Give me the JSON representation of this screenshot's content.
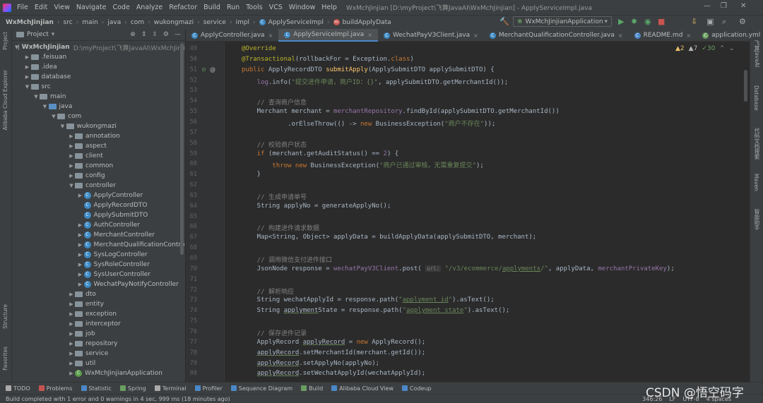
{
  "menu": [
    "File",
    "Edit",
    "View",
    "Navigate",
    "Code",
    "Analyze",
    "Refactor",
    "Build",
    "Run",
    "Tools",
    "VCS",
    "Window",
    "Help"
  ],
  "window_title": "WxMchJinjian [D:\\myProject\\飞算JavaAI\\WxMchJinjian] - ApplyServiceImpl.java",
  "breadcrumbs": [
    "WxMchJinjian",
    "src",
    "main",
    "java",
    "com",
    "wukongmazi",
    "service",
    "impl",
    "ApplyServiceImpl",
    "buildApplyData"
  ],
  "run_config": "WxMchJinjianApplication",
  "project_panel": {
    "title": "Project",
    "tree": [
      {
        "depth": 0,
        "label": "WxMchJinjian",
        "path": "D:\\myProject\\飞算JavaAI\\WxMchJinji",
        "type": "project",
        "open": true
      },
      {
        "depth": 1,
        "label": ".feisuan",
        "type": "folder",
        "open": false
      },
      {
        "depth": 1,
        "label": ".idea",
        "type": "folder",
        "open": false
      },
      {
        "depth": 1,
        "label": "database",
        "type": "folder",
        "open": false
      },
      {
        "depth": 1,
        "label": "src",
        "type": "folder",
        "open": true
      },
      {
        "depth": 2,
        "label": "main",
        "type": "folder",
        "open": true
      },
      {
        "depth": 3,
        "label": "java",
        "type": "src",
        "open": true
      },
      {
        "depth": 4,
        "label": "com",
        "type": "folder",
        "open": true
      },
      {
        "depth": 5,
        "label": "wukongmazi",
        "type": "folder",
        "open": true
      },
      {
        "depth": 6,
        "label": "annotation",
        "type": "folder",
        "open": false
      },
      {
        "depth": 6,
        "label": "aspect",
        "type": "folder",
        "open": false
      },
      {
        "depth": 6,
        "label": "client",
        "type": "folder",
        "open": false
      },
      {
        "depth": 6,
        "label": "common",
        "type": "folder",
        "open": false
      },
      {
        "depth": 6,
        "label": "config",
        "type": "folder",
        "open": false
      },
      {
        "depth": 6,
        "label": "controller",
        "type": "folder",
        "open": true
      },
      {
        "depth": 7,
        "label": "ApplyController",
        "type": "class",
        "open": false
      },
      {
        "depth": 7,
        "label": "ApplyRecordDTO",
        "type": "class",
        "open": null
      },
      {
        "depth": 7,
        "label": "ApplySubmitDTO",
        "type": "class",
        "open": null
      },
      {
        "depth": 7,
        "label": "AuthController",
        "type": "class",
        "open": false
      },
      {
        "depth": 7,
        "label": "MerchantController",
        "type": "class",
        "open": false
      },
      {
        "depth": 7,
        "label": "MerchantQualificationContro",
        "type": "class",
        "open": false
      },
      {
        "depth": 7,
        "label": "SysLogController",
        "type": "class",
        "open": false
      },
      {
        "depth": 7,
        "label": "SysRoleController",
        "type": "class",
        "open": false
      },
      {
        "depth": 7,
        "label": "SysUserController",
        "type": "class",
        "open": false
      },
      {
        "depth": 7,
        "label": "WechatPayNotifyController",
        "type": "class",
        "open": false
      },
      {
        "depth": 6,
        "label": "dto",
        "type": "folder",
        "open": false
      },
      {
        "depth": 6,
        "label": "entity",
        "type": "folder",
        "open": false
      },
      {
        "depth": 6,
        "label": "exception",
        "type": "folder",
        "open": false
      },
      {
        "depth": 6,
        "label": "interceptor",
        "type": "folder",
        "open": false
      },
      {
        "depth": 6,
        "label": "job",
        "type": "folder",
        "open": false
      },
      {
        "depth": 6,
        "label": "repository",
        "type": "folder",
        "open": false
      },
      {
        "depth": 6,
        "label": "service",
        "type": "folder",
        "open": false
      },
      {
        "depth": 6,
        "label": "util",
        "type": "folder",
        "open": false
      },
      {
        "depth": 6,
        "label": "WxMchJinjianApplication",
        "type": "spring",
        "open": false
      }
    ]
  },
  "tabs": [
    {
      "label": "ApplyController.java",
      "active": false,
      "icon": "#3d8ac4"
    },
    {
      "label": "ApplyServiceImpl.java",
      "active": true,
      "icon": "#3d8ac4"
    },
    {
      "label": "WechatPayV3Client.java",
      "active": false,
      "icon": "#3d8ac4"
    },
    {
      "label": "MerchantQualificationController.java",
      "active": false,
      "icon": "#3d8ac4"
    },
    {
      "label": "README.md",
      "active": false,
      "icon": "#4a88c7"
    },
    {
      "label": "application.yml",
      "active": false,
      "icon": "#6a9e61"
    }
  ],
  "inspection": {
    "warnings": "2",
    "weak": "7",
    "ok": "30"
  },
  "code_lines": [
    {
      "n": "49",
      "html": "<span class=\"ann\">@Override</span>"
    },
    {
      "n": "50",
      "html": "<span class=\"ann\">@Transactional</span>(rollbackFor = Exception.<span class=\"kw\">class</span>)"
    },
    {
      "n": "51",
      "html": "<span class=\"kw\">public</span> ApplyRecordDTO <span class=\"fn\">submitApply</span>(ApplySubmitDTO applySubmitDTO) {"
    },
    {
      "n": "52",
      "html": "    <span class=\"fld\">log</span>.info(<span class=\"str\">\"提交进件申请，商户ID：{}\"</span>, applySubmitDTO.getMerchantId());"
    },
    {
      "n": "53",
      "html": ""
    },
    {
      "n": "54",
      "html": "    <span class=\"cmt\">// 查询商户信息</span>"
    },
    {
      "n": "55",
      "html": "    Merchant merchant = <span class=\"fld\">merchantRepository</span>.findById(applySubmitDTO.getMerchantId())"
    },
    {
      "n": "56",
      "html": "            .orElseThrow(() -> <span class=\"kw\">new</span> BusinessException(<span class=\"str\">\"商户不存在\"</span>));"
    },
    {
      "n": "57",
      "html": ""
    },
    {
      "n": "58",
      "html": "    <span class=\"cmt\">// 校验商户状态</span>"
    },
    {
      "n": "59",
      "html": "    <span class=\"kw\">if</span> (merchant.getAuditStatus() == <span class=\"fld\">2</span>) {"
    },
    {
      "n": "60",
      "html": "        <span class=\"kw\">throw new</span> BusinessException(<span class=\"str\">\"商户已通过审核，无需重复提交\"</span>);"
    },
    {
      "n": "61",
      "html": "    }"
    },
    {
      "n": "62",
      "html": ""
    },
    {
      "n": "63",
      "html": "    <span class=\"cmt\">// 生成申请单号</span>"
    },
    {
      "n": "64",
      "html": "    String applyNo = generateApplyNo();"
    },
    {
      "n": "65",
      "html": ""
    },
    {
      "n": "66",
      "html": "    <span class=\"cmt\">// 构建进件请求数据</span>"
    },
    {
      "n": "67",
      "html": "    Map&lt;String, Object&gt; applyData = buildApplyData(applySubmitDTO, merchant);"
    },
    {
      "n": "68",
      "html": ""
    },
    {
      "n": "69",
      "html": "    <span class=\"cmt\">// 调用微信支付进件接口</span>"
    },
    {
      "n": "70",
      "html": "    JsonNode response = <span class=\"fld\">wechatPayV3Client</span>.post( <span class=\"hint\">url:</span> <span class=\"str\">\"/v3/ecommerce/<span class=\"ul\">applyments</span>/\"</span>, applyData, <span class=\"fld\">merchantPrivateKey</span>);"
    },
    {
      "n": "71",
      "html": ""
    },
    {
      "n": "72",
      "html": "    <span class=\"cmt\">// 解析响应</span>"
    },
    {
      "n": "73",
      "html": "    String wechatApplyId = response.path(<span class=\"str\">\"<span class=\"ul\">applyment_id</span>\"</span>).asText();"
    },
    {
      "n": "74",
      "html": "    String <span class=\"ul\">applyment</span>State = response.path(<span class=\"str\">\"<span class=\"ul\">applyment_state</span>\"</span>).asText();"
    },
    {
      "n": "75",
      "html": ""
    },
    {
      "n": "76",
      "html": "    <span class=\"cmt\">// 保存进件记录</span>"
    },
    {
      "n": "77",
      "html": "    ApplyRecord <span class=\"ul\">applyRecord</span> = <span class=\"kw\">new</span> ApplyRecord();"
    },
    {
      "n": "78",
      "html": "    <span class=\"ul\">applyRecord</span>.setMerchantId(merchant.getId());"
    },
    {
      "n": "79",
      "html": "    <span class=\"ul\">applyRecord</span>.setApplyNo(applyNo);"
    },
    {
      "n": "80",
      "html": "    <span class=\"ul\">applyRecord</span>.setWechatApplyId(wechatApplyId);"
    }
  ],
  "tool_windows": [
    "TODO",
    "Problems",
    "Statistic",
    "Spring",
    "Terminal",
    "Profiler",
    "Sequence Diagram",
    "Build",
    "Alibaba Cloud View",
    "Codeup"
  ],
  "left_stripe": [
    "Project",
    "Alibaba Cloud Explorer",
    "Structure",
    "Favorites"
  ],
  "right_stripe": [
    "飞算JavaAI",
    "Database",
    "代码文档搜索",
    "Maven",
    "智能助手"
  ],
  "status": {
    "message": "Build completed with 1 error and 0 warnings in 4 sec, 999 ms (18 minutes ago)",
    "position": "346:26",
    "line_sep": "LF",
    "encoding": "UTF-8",
    "indent": "4 spaces"
  },
  "watermark": "CSDN @悟空码字"
}
